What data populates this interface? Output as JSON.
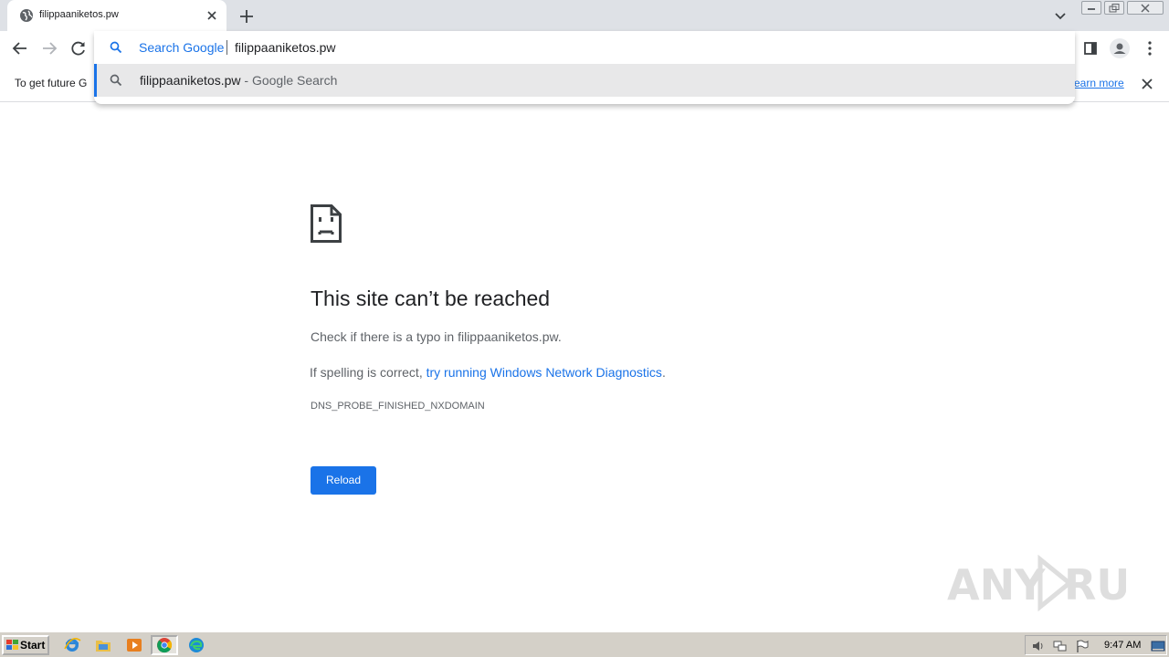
{
  "tab": {
    "title": "filippaaniketos.pw"
  },
  "omnibox": {
    "keyword": "Search Google",
    "input_value": "filippaaniketos.pw",
    "suggestion_text": "filippaaniketos.pw",
    "suggestion_suffix": " - Google Search"
  },
  "infobar": {
    "text": "To get future G",
    "learn_more": "earn more"
  },
  "error": {
    "title": "This site can’t be reached",
    "check_prefix": "Check if there is a typo in ",
    "domain": "filippaaniketos.pw",
    "check_suffix": ".",
    "spelling_prefix": "If spelling is correct, ",
    "diagnostics_link": "try running Windows Network Diagnostics",
    "spelling_suffix": ".",
    "code": "DNS_PROBE_FINISHED_NXDOMAIN",
    "reload_label": "Reload"
  },
  "watermark": {
    "text": "ANY RUN"
  },
  "taskbar": {
    "start_label": "Start",
    "clock": "9:47 AM",
    "apps": [
      "internet-explorer-icon",
      "file-explorer-icon",
      "media-player-icon",
      "chrome-icon",
      "edge-icon"
    ]
  },
  "colors": {
    "accent": "#1a73e8",
    "tabstrip": "#dee1e6",
    "suggestion_highlight": "#e8e8e9",
    "taskbar": "#d4d0c8"
  }
}
